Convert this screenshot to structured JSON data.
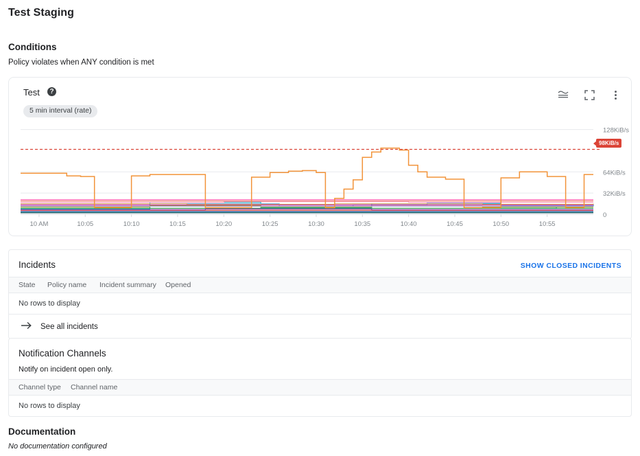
{
  "page": {
    "title": "Test Staging"
  },
  "conditions": {
    "heading": "Conditions",
    "subtitle": "Policy violates when ANY condition is met",
    "card": {
      "title": "Test",
      "help_icon": "help-icon",
      "chip": "5 min interval (rate)",
      "tools": [
        {
          "name": "chart-legend-icon",
          "label": "Chart options"
        },
        {
          "name": "fullscreen-icon",
          "label": "Expand"
        },
        {
          "name": "more-vert-icon",
          "label": "More options"
        }
      ],
      "threshold_label": "98KiB/s"
    }
  },
  "chart_data": {
    "type": "line",
    "title": "Test",
    "xlabel": "",
    "ylabel": "",
    "unit": "KiB/s",
    "grid": true,
    "legend": "none",
    "threshold": {
      "value": 98,
      "label": "98KiB/s",
      "color": "#db4437",
      "style": "dashed"
    },
    "ytick_labels": [
      "128KiB/s",
      "64KiB/s",
      "32KiB/s",
      "0"
    ],
    "ytick_values": [
      128,
      64,
      32,
      0
    ],
    "ylim": [
      0,
      140
    ],
    "xtick_labels": [
      "10 AM",
      "10:05",
      "10:10",
      "10:15",
      "10:20",
      "10:25",
      "10:30",
      "10:35",
      "10:40",
      "10:45",
      "10:50",
      "10:55"
    ],
    "x_minutes": [
      0,
      5,
      10,
      15,
      20,
      25,
      30,
      35,
      40,
      45,
      50,
      55
    ],
    "xlim": [
      -2,
      60
    ],
    "series": [
      {
        "name": "primary-orange",
        "color": "#f29339",
        "x": [
          -2,
          1,
          3,
          4.5,
          6,
          7,
          8,
          10,
          12,
          14.5,
          16,
          18,
          20,
          21.5,
          23,
          25,
          27,
          28.5,
          30,
          31,
          32,
          33,
          34,
          35,
          36,
          37,
          38,
          39,
          40,
          41,
          42,
          44,
          46,
          48,
          50,
          52,
          53,
          55,
          57,
          59,
          60
        ],
        "values": [
          62,
          62,
          58,
          57,
          10,
          10,
          10,
          58,
          60,
          60,
          60,
          10,
          10,
          10,
          56,
          63,
          65,
          66,
          63,
          10,
          24,
          38,
          52,
          86,
          94,
          100,
          100,
          97,
          74,
          64,
          56,
          53,
          10,
          10,
          55,
          64,
          64,
          57,
          10,
          60,
          60
        ]
      },
      {
        "name": "cyan-a",
        "color": "#12b5cb",
        "x": [
          -2,
          8,
          12,
          20,
          24,
          30,
          36,
          44,
          50,
          56,
          60
        ],
        "values": [
          8,
          8,
          18,
          18,
          10,
          10,
          16,
          16,
          9,
          14,
          12
        ]
      },
      {
        "name": "blue-light",
        "color": "#6aa8f5",
        "x": [
          -2,
          10,
          16,
          26,
          34,
          42,
          50,
          60
        ],
        "values": [
          12,
          12,
          16,
          12,
          14,
          17,
          13,
          13
        ]
      },
      {
        "name": "pink-hot",
        "color": "#ff4fa3",
        "x": [
          -2,
          60
        ],
        "values": [
          22,
          22
        ]
      },
      {
        "name": "pink-pale",
        "color": "#f8a3c4",
        "x": [
          -2,
          20,
          40,
          60
        ],
        "values": [
          18,
          19,
          18,
          18
        ]
      },
      {
        "name": "magenta",
        "color": "#c5299b",
        "x": [
          -2,
          60
        ],
        "values": [
          14,
          14
        ]
      },
      {
        "name": "crimson",
        "color": "#c5221f",
        "x": [
          -2,
          60
        ],
        "values": [
          6,
          6
        ]
      },
      {
        "name": "olive",
        "color": "#9aa132",
        "x": [
          -2,
          12,
          24,
          36,
          48,
          60
        ],
        "values": [
          11,
          13,
          11,
          12,
          11,
          11
        ]
      },
      {
        "name": "green-dark",
        "color": "#1e8e3e",
        "x": [
          -2,
          60
        ],
        "values": [
          9,
          9
        ]
      },
      {
        "name": "purple",
        "color": "#8e44ad",
        "x": [
          -2,
          18,
          36,
          60
        ],
        "values": [
          7,
          8,
          7,
          7
        ]
      },
      {
        "name": "navy",
        "color": "#3f51b5",
        "x": [
          -2,
          60
        ],
        "values": [
          4,
          4
        ]
      },
      {
        "name": "tan",
        "color": "#d8a06a",
        "x": [
          -2,
          16,
          32,
          48,
          60
        ],
        "values": [
          16,
          15,
          16,
          15,
          16
        ]
      },
      {
        "name": "lavender",
        "color": "#b39ddb",
        "x": [
          -2,
          60
        ],
        "values": [
          12,
          12
        ]
      },
      {
        "name": "salmon",
        "color": "#ef7b6f",
        "x": [
          -2,
          28,
          60
        ],
        "values": [
          20,
          20,
          20
        ]
      },
      {
        "name": "teal-dark",
        "color": "#00796b",
        "x": [
          -2,
          60
        ],
        "values": [
          3,
          3
        ]
      },
      {
        "name": "grey-blue",
        "color": "#78909c",
        "x": [
          -2,
          60
        ],
        "values": [
          2,
          2
        ]
      }
    ]
  },
  "incidents": {
    "title": "Incidents",
    "show_closed_link": "SHOW CLOSED INCIDENTS",
    "link_color": "#1a73e8",
    "columns": [
      "State",
      "Policy name",
      "Incident summary",
      "Opened"
    ],
    "empty_text": "No rows to display",
    "see_all_label": "See all incidents",
    "see_all_icon": "arrow-right-icon",
    "rows": []
  },
  "notification_channels": {
    "title": "Notification Channels",
    "note": "Notify on incident open only.",
    "columns": [
      "Channel type",
      "Channel name"
    ],
    "empty_text": "No rows to display",
    "rows": []
  },
  "documentation": {
    "heading": "Documentation",
    "empty_text": "No documentation configured"
  }
}
